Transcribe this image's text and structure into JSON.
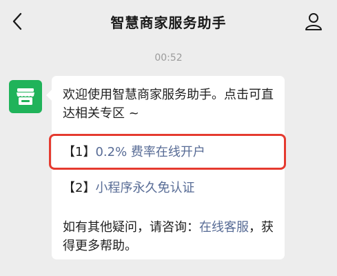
{
  "header": {
    "title": "智慧商家服务助手",
    "back_icon": "chevron-left-icon",
    "user_icon": "user-icon"
  },
  "chat": {
    "timestamp": "00:52",
    "avatar_icon": "store-icon",
    "message": {
      "intro": "欢迎使用智慧商家服务助手。点击可直达相关专区 ~",
      "items": [
        {
          "number": "【1】",
          "label": "0.2% 费率在线开户"
        },
        {
          "number": "【2】",
          "label": "小程序永久免认证"
        }
      ],
      "footer_prefix": "如有其他疑问，请咨询：",
      "footer_link": "在线客服",
      "footer_suffix": "，获得更多帮助。"
    }
  },
  "colors": {
    "background": "#ededed",
    "link": "#576b95",
    "avatar": "#20b35a",
    "highlight_border": "#e53a2f"
  }
}
